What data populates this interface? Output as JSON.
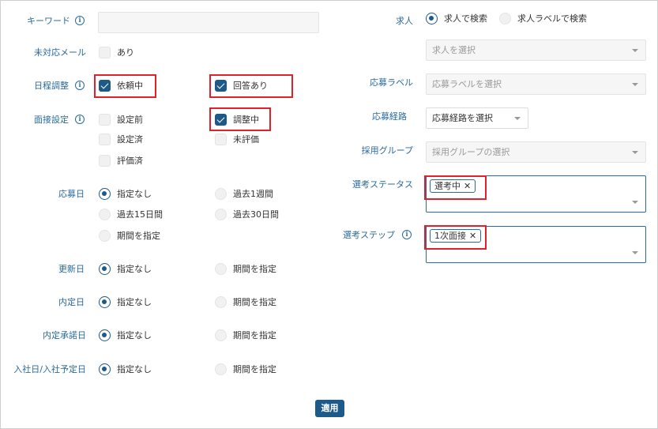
{
  "left": {
    "keyword": {
      "label": "キーワード",
      "value": ""
    },
    "unresponded_mail": {
      "label": "未対応メール",
      "option": "あり"
    },
    "schedule": {
      "label": "日程調整",
      "opt1": "依頼中",
      "opt2": "回答あり"
    },
    "interview": {
      "label": "面接設定",
      "opt1": "設定前",
      "opt2": "調整中",
      "opt3": "設定済",
      "opt4": "未評価",
      "opt5": "評価済"
    },
    "apply_date": {
      "label": "応募日",
      "opt1": "指定なし",
      "opt2": "過去1週間",
      "opt3": "過去15日間",
      "opt4": "過去30日間",
      "opt5": "期間を指定"
    },
    "update_date": {
      "label": "更新日",
      "opt1": "指定なし",
      "opt2": "期間を指定"
    },
    "offer_date": {
      "label": "内定日",
      "opt1": "指定なし",
      "opt2": "期間を指定"
    },
    "offer_accept_date": {
      "label": "内定承諾日",
      "opt1": "指定なし",
      "opt2": "期間を指定"
    },
    "join_date": {
      "label": "入社日/入社予定日",
      "opt1": "指定なし",
      "opt2": "期間を指定"
    }
  },
  "right": {
    "job": {
      "label": "求人",
      "radio1": "求人で検索",
      "radio2": "求人ラベルで検索",
      "placeholder": "求人を選択"
    },
    "apply_label": {
      "label": "応募ラベル",
      "placeholder": "応募ラベルを選択"
    },
    "apply_route": {
      "label": "応募経路",
      "placeholder": "応募経路を選択"
    },
    "hiring_group": {
      "label": "採用グループ",
      "placeholder": "採用グループの選択"
    },
    "selection_status": {
      "label": "選考ステータス",
      "tag": "選考中",
      "tag_close": "✕"
    },
    "selection_step": {
      "label": "選考ステップ",
      "tag": "1次面接",
      "tag_close": "✕"
    }
  },
  "apply_button": "適用",
  "icons": {
    "info": "i"
  },
  "colors": {
    "accent": "#1d5a8a",
    "label": "#2a6a9a",
    "highlight": "#e0202a"
  }
}
